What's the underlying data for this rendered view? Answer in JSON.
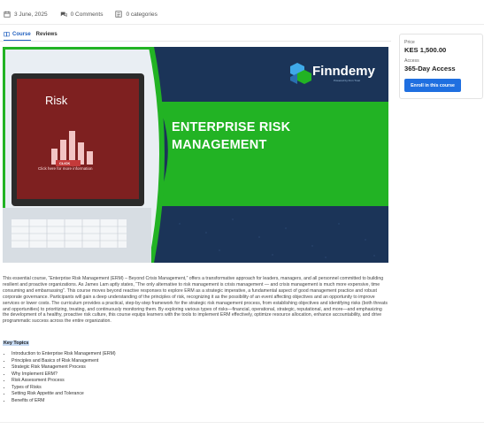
{
  "meta": {
    "date": "3 June, 2025",
    "comments": "0 Comments",
    "categories": "0 categories"
  },
  "tabs": [
    {
      "label": "Course",
      "active": true
    },
    {
      "label": "Reviews",
      "active": false
    }
  ],
  "banner": {
    "brand_name": "Finndemy",
    "brand_tagline": "Powered by Finn Trust",
    "title_line1": "ENTERPRISE RISK",
    "title_line2": "MANAGEMENT",
    "screen_heading": "Risk",
    "screen_button": "CLICK",
    "screen_caption": "Click here for more information",
    "colors": {
      "navy": "#1b3458",
      "green": "#22b324",
      "accent_blue": "#3fa9e8"
    }
  },
  "description": "This essential course, “Enterprise Risk Management (ERM) – Beyond Crisis Management,” offers a transformative approach for leaders, managers, and all personnel committed to building resilient and proactive organizations. As James Lam aptly states, “The only alternative to risk management is crisis management — and crisis management is much more expensive, time consuming and embarrassing”. This course moves beyond reactive responses to explore ERM as a strategic imperative, a fundamental aspect of good management practice and robust corporate governance. Participants will gain a deep understanding of the principles of risk, recognizing it as the possibility of an event affecting objectives and an opportunity to improve services or lower costs. The curriculum provides a practical, step-by-step framework for the strategic risk management process, from establishing objectives and identifying risks (both threats and opportunities) to prioritizing, treating, and continuously monitoring them. By exploring various types of risks—financial, operational, strategic, reputational, and more—and emphasizing the development of a healthy, proactive risk culture, this course equips learners with the tools to implement ERM effectively, optimize resource allocation, enhance accountability, and drive programmatic success across the entire organization.",
  "key_topics_label": "Key Topics",
  "topics": [
    "Introduction to Enterprise Risk Management (ERM)",
    "Principles and Basics of Risk Management",
    "Strategic Risk Management Process",
    "Why Implement ERM?",
    "Risk Assessment Process",
    "Types of Risks",
    "Setting Risk Appetite and Tolerance",
    "Benefits of ERM"
  ],
  "sidebar": {
    "price_label": "Price",
    "price_value": "KES 1,500.00",
    "access_label": "Access",
    "access_value": "365-Day Access",
    "enroll_label": "Enroll in this course",
    "accent": "#1f6fe0"
  }
}
